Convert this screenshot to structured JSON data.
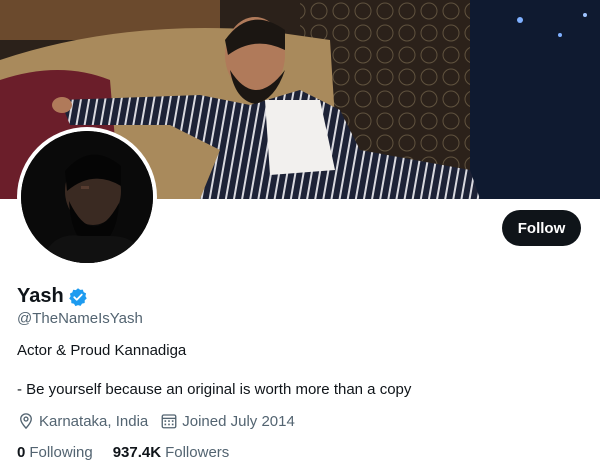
{
  "profile": {
    "display_name": "Yash",
    "verified": true,
    "handle": "@TheNameIsYash",
    "bio_line1": "Actor & Proud Kannadiga",
    "bio_line2": "- Be yourself because an original is worth more than a copy",
    "location": "Karnataka, India",
    "joined": "Joined July 2014",
    "following_count": "0",
    "following_label": "Following",
    "followers_count": "937.4K",
    "followers_label": "Followers"
  },
  "actions": {
    "follow_label": "Follow"
  },
  "colors": {
    "text_primary": "#0f1419",
    "text_secondary": "#536471",
    "verified_blue": "#1d9bf0",
    "button_bg": "#0f1419"
  },
  "icons": {
    "verified": "verified-badge-icon",
    "location": "location-pin-icon",
    "calendar": "calendar-icon"
  }
}
